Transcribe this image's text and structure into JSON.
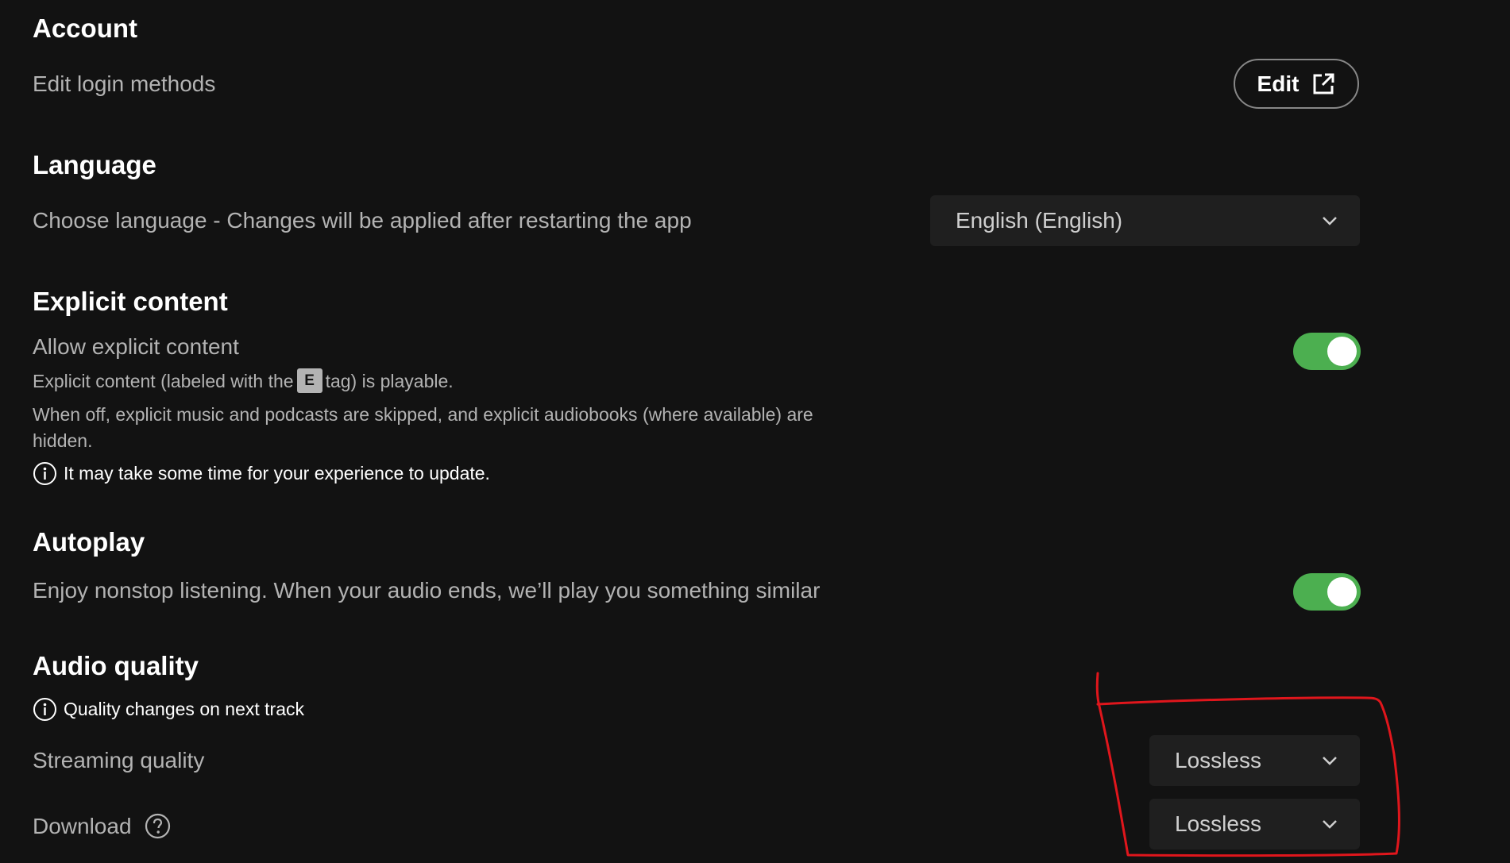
{
  "account": {
    "title": "Account",
    "label": "Edit login methods",
    "button_label": "Edit"
  },
  "language": {
    "title": "Language",
    "label": "Choose language - Changes will be applied after restarting the app",
    "selected": "English (English)"
  },
  "explicit": {
    "title": "Explicit content",
    "label": "Allow explicit content",
    "desc_before_tag": "Explicit content (labeled with the",
    "tag": "E",
    "desc_after_tag": "tag) is playable.",
    "desc2": "When off, explicit music and podcasts are skipped, and explicit audiobooks (where available) are hidden.",
    "note": "It may take some time for your experience to update.",
    "enabled": true
  },
  "autoplay": {
    "title": "Autoplay",
    "label": "Enjoy nonstop listening. When your audio ends, we’ll play you something similar",
    "enabled": true
  },
  "audio_quality": {
    "title": "Audio quality",
    "note": "Quality changes on next track",
    "streaming_label": "Streaming quality",
    "streaming_value": "Lossless",
    "download_label": "Download",
    "download_value": "Lossless"
  },
  "colors": {
    "background": "#121212",
    "toggle_on": "#4caf50",
    "annotation": "#e0161c"
  }
}
